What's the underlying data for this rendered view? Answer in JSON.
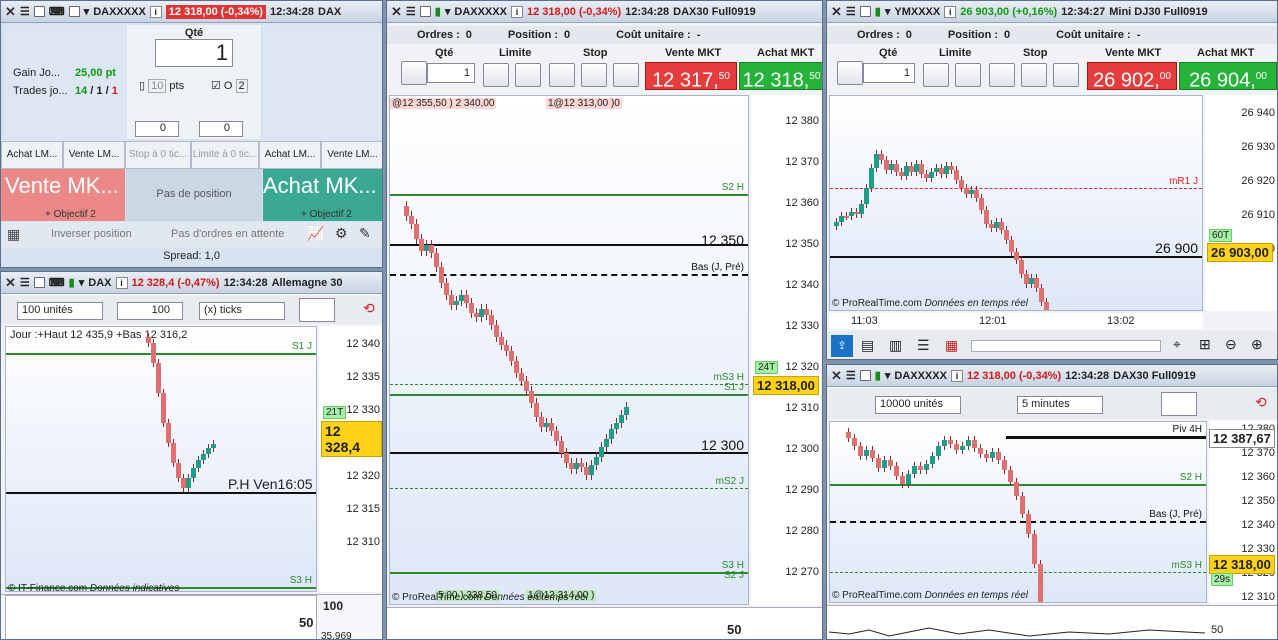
{
  "tl": {
    "title": "DAXXXXX",
    "change": "12 318,00 (-0,34%)",
    "time": "12:34:28",
    "name": "DAX",
    "qty_label": "Qté",
    "qty": "1",
    "gain_label": "Gain Jo...",
    "gain": "25,00 pt",
    "trades_label": "Trades jo...",
    "trades_a": "14",
    "trades_b": "1",
    "trades_c": "1",
    "pts_val": "10",
    "pts": "pts",
    "o_label": "O",
    "o_val": "2",
    "stepper1": "0",
    "stepper2": "0",
    "btn_buy_lm": "Achat LM...",
    "btn_sell_lm": "Vente LM...",
    "btn_stop": "Stop à 0 tic...",
    "btn_limit": "Limite à 0 tic...",
    "btn_buy_lm2": "Achat LM...",
    "btn_sell_lm2": "Vente LM...",
    "sell_mkt": "Vente MK...",
    "no_pos": "Pas de position",
    "buy_mkt": "Achat MK...",
    "obj1": "+ Objectif 2",
    "obj2": "+ Objectif 2",
    "reverse": "Inverser position",
    "no_orders": "Pas d'ordres en attente",
    "spread": "Spread:  1,0"
  },
  "bl": {
    "title": "DAX",
    "change": "12 328,4 (-0,47%)",
    "time": "12:34:28",
    "name": "Allemagne 30",
    "units": "100 unités",
    "ticks_val": "100",
    "ticks": "(x) ticks",
    "day_info": "Jour :+Haut 12 435,9 +Bas 12 316,2",
    "s1": "S1 J",
    "s3": "S3 H",
    "ph": "P.H Ven16:05",
    "badge": "12 328,4",
    "tbadge": "21T",
    "copy_a": "© IT-Finance.com",
    "copy_b": "Données indicatives",
    "osc1": "100",
    "osc2": "50",
    "osc3": "35,969",
    "ticks_y": [
      "12 340",
      "12 335",
      "12 330",
      "12 325",
      "12 320",
      "12 315",
      "12 310"
    ]
  },
  "mid": {
    "title": "DAXXXXX",
    "change": "12 318,00 (-0,34%)",
    "time": "12:34:28",
    "name": "DAX30 Full0919",
    "orders_label": "Ordres :",
    "orders": "0",
    "pos_label": "Position :",
    "pos": "0",
    "cost_label": "Coût unitaire :",
    "cost": "-",
    "h_qty": "Qté",
    "h_limit": "Limite",
    "h_stop": "Stop",
    "h_sell": "Vente MKT",
    "h_buy": "Achat MKT",
    "qty": "1",
    "sell_main": "12 317,",
    "sell_sup": "50",
    "buy_main": "12 318,",
    "buy_sup": "50",
    "tag1": "@12 355,50 ) 2 340,00",
    "tag2": "1@12 313,00 )0",
    "tag3": "5,00 ) 338,50",
    "tag4": "1@12 314,00 )",
    "s2": "S2 H",
    "m1": "12 350",
    "bas": "Bas (J, Pré)",
    "ms3": "mS3 H",
    "s1": "S1 J",
    "l12300": "12 300",
    "ms2": "mS2 J",
    "s3": "S3 H",
    "s2b": "S2 J",
    "badge": "12 318,00",
    "tbadge": "24T",
    "copy_a": "© ProRealTime.com",
    "copy_b": "Données en temps réel",
    "osc": "50",
    "ticks_y": [
      "12 380",
      "12 370",
      "12 360",
      "12 350",
      "12 340",
      "12 330",
      "12 320",
      "12 310",
      "12 300",
      "12 290",
      "12 280",
      "12 270"
    ]
  },
  "tr": {
    "title": "YMXXXX",
    "change": "26 903,00 (+0,16%)",
    "time": "12:34:27",
    "name": "Mini DJ30 Full0919",
    "orders_label": "Ordres :",
    "orders": "0",
    "pos_label": "Position :",
    "pos": "0",
    "cost_label": "Coût unitaire :",
    "cost": "-",
    "h_qty": "Qté",
    "h_limit": "Limite",
    "h_stop": "Stop",
    "h_sell": "Vente MKT",
    "h_buy": "Achat MKT",
    "qty": "1",
    "sell_main": "26 902,",
    "sell_sup": "00",
    "buy_main": "26 904,",
    "buy_sup": "00",
    "mr1": "mR1 J",
    "l26900": "26 900",
    "badge": "26 903,00",
    "tbadge": "60T",
    "copy_a": "© ProRealTime.com",
    "copy_b": "Données en temps réel",
    "ticks_y": [
      "26 940",
      "26 930",
      "26 920",
      "26 910",
      "26 890"
    ],
    "ticks_x": [
      "11:03",
      "12:01",
      "13:02"
    ]
  },
  "br": {
    "title": "DAXXXXX",
    "change": "12 318,00 (-0,34%)",
    "time": "12:34:28",
    "name": "DAX30 Full0919",
    "units": "10000 unités",
    "period": "5 minutes",
    "piv": "Piv 4H",
    "s2": "S2 H",
    "bas": "Bas (J, Pré)",
    "ms3": "mS3 H",
    "badge1": "12 387,67",
    "badge2": "12 318,00",
    "tbadge": "29s",
    "copy_a": "© ProRealTime.com",
    "copy_b": "Données en temps réel",
    "osc": "50",
    "ticks_y": [
      "12 380",
      "12 370",
      "12 360",
      "12 350",
      "12 340",
      "12 330",
      "12 320",
      "12 310"
    ]
  }
}
